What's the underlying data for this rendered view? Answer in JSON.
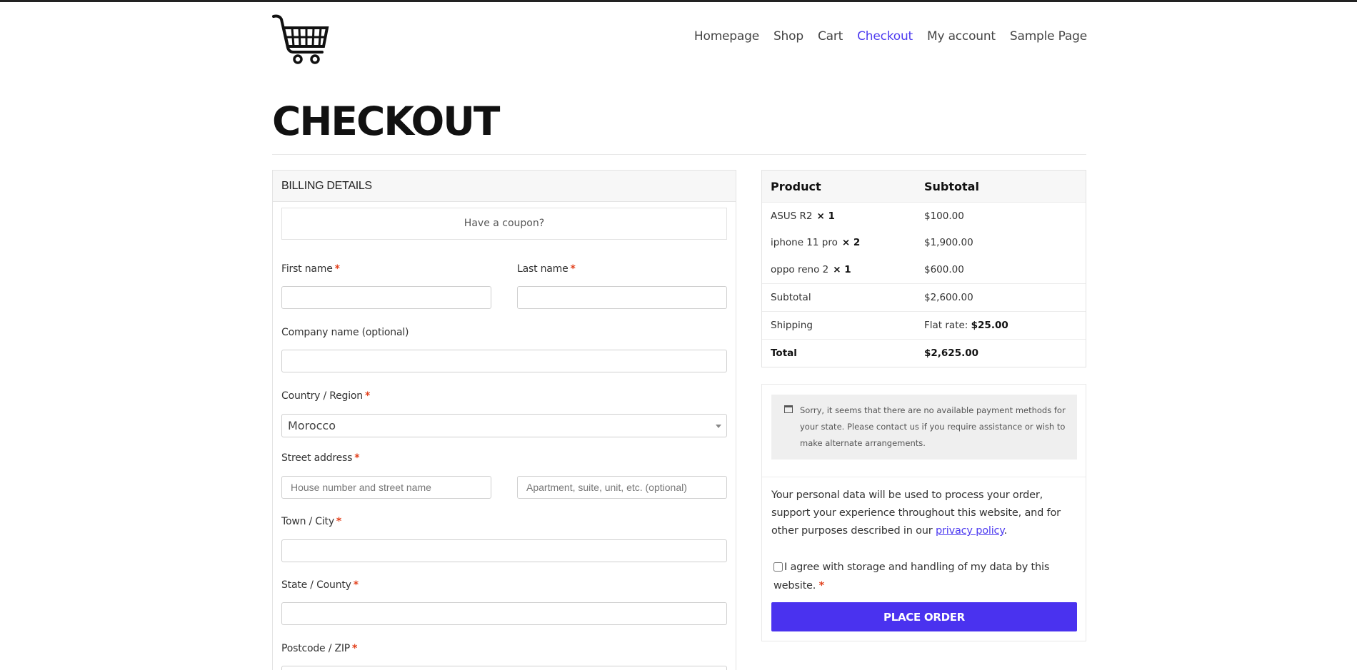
{
  "nav": {
    "items": [
      {
        "label": "Homepage"
      },
      {
        "label": "Shop"
      },
      {
        "label": "Cart"
      },
      {
        "label": "Checkout",
        "active": true
      },
      {
        "label": "My account"
      },
      {
        "label": "Sample Page"
      }
    ]
  },
  "logo": {
    "icon": "shopping-cart-icon"
  },
  "page": {
    "title": "CHECKOUT"
  },
  "billing": {
    "heading": "BILLING DETAILS",
    "coupon": "Have a coupon?",
    "first_name": {
      "label": "First name",
      "required": "*",
      "value": ""
    },
    "last_name": {
      "label": "Last name",
      "required": "*",
      "value": ""
    },
    "company": {
      "label": "Company name",
      "optional": "(optional)",
      "value": ""
    },
    "country": {
      "label": "Country / Region",
      "required": "*",
      "value": "Morocco"
    },
    "street": {
      "label": "Street address",
      "required": "*",
      "placeholder1": "House number and street name",
      "placeholder2": "Apartment, suite, unit, etc. (optional)"
    },
    "city": {
      "label": "Town / City",
      "required": "*",
      "value": ""
    },
    "state": {
      "label": "State / County",
      "required": "*",
      "value": ""
    },
    "postcode": {
      "label": "Postcode / ZIP",
      "required": "*",
      "value": ""
    }
  },
  "order": {
    "col_product": "Product",
    "col_subtotal": "Subtotal",
    "items": [
      {
        "name": "ASUS R2",
        "qty": "× 1",
        "price": "$100.00"
      },
      {
        "name": "iphone 11 pro",
        "qty": "× 2",
        "price": "$1,900.00"
      },
      {
        "name": "oppo reno 2",
        "qty": "× 1",
        "price": "$600.00"
      }
    ],
    "subtotal_label": "Subtotal",
    "subtotal_value": "$2,600.00",
    "shipping_label": "Shipping",
    "shipping_method": "Flat rate:",
    "shipping_value": "$25.00",
    "total_label": "Total",
    "total_value": "$2,625.00"
  },
  "payment": {
    "notice_icon": "calendar-icon",
    "notice": "Sorry, it seems that there are no available payment methods for your state. Please contact us if you require assistance or wish to make alternate arrangements.",
    "privacy_text": "Your personal data will be used to process your order, support your experience throughout this website, and for other purposes described in our",
    "privacy_link": "privacy policy",
    "privacy_end": ".",
    "agree_text": "I agree with storage and handling of my data by this website.",
    "agree_required": "*",
    "place_order": "PLACE ORDER"
  },
  "colors": {
    "accent": "#4a32ef",
    "required": "#e2401c"
  }
}
